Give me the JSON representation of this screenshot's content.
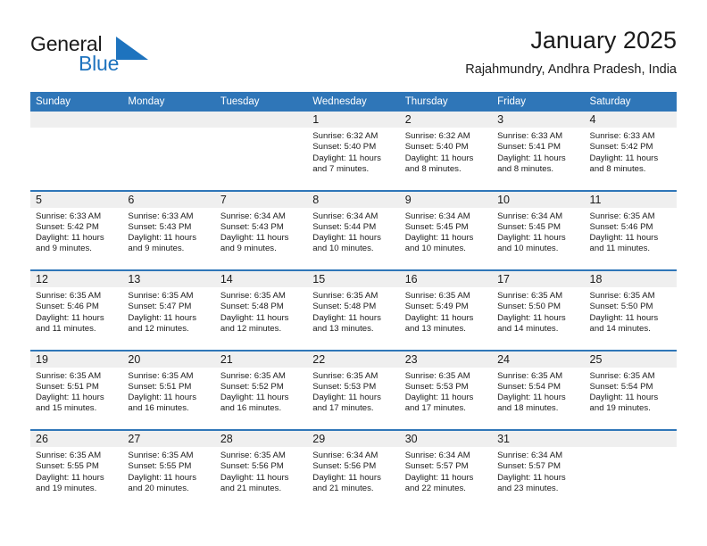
{
  "brand": {
    "name_dark": "General",
    "name_blue": "Blue",
    "triangle_color": "#1e73be"
  },
  "header": {
    "title": "January 2025",
    "subtitle": "Rajahmundry, Andhra Pradesh, India"
  },
  "theme": {
    "header_blue": "#2f76b8",
    "row_divider_blue": "#2f76b8",
    "day_band_gray": "#efefef",
    "text_color": "#1b1b1b",
    "brand_blue": "#1e73be"
  },
  "weekdays": [
    "Sunday",
    "Monday",
    "Tuesday",
    "Wednesday",
    "Thursday",
    "Friday",
    "Saturday"
  ],
  "weeks": [
    [
      {
        "day": "",
        "sunrise": "",
        "sunset": "",
        "daylight_line1": "",
        "daylight_line2": "",
        "empty": true
      },
      {
        "day": "",
        "sunrise": "",
        "sunset": "",
        "daylight_line1": "",
        "daylight_line2": "",
        "empty": true
      },
      {
        "day": "",
        "sunrise": "",
        "sunset": "",
        "daylight_line1": "",
        "daylight_line2": "",
        "empty": true
      },
      {
        "day": "1",
        "sunrise": "Sunrise: 6:32 AM",
        "sunset": "Sunset: 5:40 PM",
        "daylight_line1": "Daylight: 11 hours",
        "daylight_line2": "and 7 minutes.",
        "empty": false
      },
      {
        "day": "2",
        "sunrise": "Sunrise: 6:32 AM",
        "sunset": "Sunset: 5:40 PM",
        "daylight_line1": "Daylight: 11 hours",
        "daylight_line2": "and 8 minutes.",
        "empty": false
      },
      {
        "day": "3",
        "sunrise": "Sunrise: 6:33 AM",
        "sunset": "Sunset: 5:41 PM",
        "daylight_line1": "Daylight: 11 hours",
        "daylight_line2": "and 8 minutes.",
        "empty": false
      },
      {
        "day": "4",
        "sunrise": "Sunrise: 6:33 AM",
        "sunset": "Sunset: 5:42 PM",
        "daylight_line1": "Daylight: 11 hours",
        "daylight_line2": "and 8 minutes.",
        "empty": false
      }
    ],
    [
      {
        "day": "5",
        "sunrise": "Sunrise: 6:33 AM",
        "sunset": "Sunset: 5:42 PM",
        "daylight_line1": "Daylight: 11 hours",
        "daylight_line2": "and 9 minutes.",
        "empty": false
      },
      {
        "day": "6",
        "sunrise": "Sunrise: 6:33 AM",
        "sunset": "Sunset: 5:43 PM",
        "daylight_line1": "Daylight: 11 hours",
        "daylight_line2": "and 9 minutes.",
        "empty": false
      },
      {
        "day": "7",
        "sunrise": "Sunrise: 6:34 AM",
        "sunset": "Sunset: 5:43 PM",
        "daylight_line1": "Daylight: 11 hours",
        "daylight_line2": "and 9 minutes.",
        "empty": false
      },
      {
        "day": "8",
        "sunrise": "Sunrise: 6:34 AM",
        "sunset": "Sunset: 5:44 PM",
        "daylight_line1": "Daylight: 11 hours",
        "daylight_line2": "and 10 minutes.",
        "empty": false
      },
      {
        "day": "9",
        "sunrise": "Sunrise: 6:34 AM",
        "sunset": "Sunset: 5:45 PM",
        "daylight_line1": "Daylight: 11 hours",
        "daylight_line2": "and 10 minutes.",
        "empty": false
      },
      {
        "day": "10",
        "sunrise": "Sunrise: 6:34 AM",
        "sunset": "Sunset: 5:45 PM",
        "daylight_line1": "Daylight: 11 hours",
        "daylight_line2": "and 10 minutes.",
        "empty": false
      },
      {
        "day": "11",
        "sunrise": "Sunrise: 6:35 AM",
        "sunset": "Sunset: 5:46 PM",
        "daylight_line1": "Daylight: 11 hours",
        "daylight_line2": "and 11 minutes.",
        "empty": false
      }
    ],
    [
      {
        "day": "12",
        "sunrise": "Sunrise: 6:35 AM",
        "sunset": "Sunset: 5:46 PM",
        "daylight_line1": "Daylight: 11 hours",
        "daylight_line2": "and 11 minutes.",
        "empty": false
      },
      {
        "day": "13",
        "sunrise": "Sunrise: 6:35 AM",
        "sunset": "Sunset: 5:47 PM",
        "daylight_line1": "Daylight: 11 hours",
        "daylight_line2": "and 12 minutes.",
        "empty": false
      },
      {
        "day": "14",
        "sunrise": "Sunrise: 6:35 AM",
        "sunset": "Sunset: 5:48 PM",
        "daylight_line1": "Daylight: 11 hours",
        "daylight_line2": "and 12 minutes.",
        "empty": false
      },
      {
        "day": "15",
        "sunrise": "Sunrise: 6:35 AM",
        "sunset": "Sunset: 5:48 PM",
        "daylight_line1": "Daylight: 11 hours",
        "daylight_line2": "and 13 minutes.",
        "empty": false
      },
      {
        "day": "16",
        "sunrise": "Sunrise: 6:35 AM",
        "sunset": "Sunset: 5:49 PM",
        "daylight_line1": "Daylight: 11 hours",
        "daylight_line2": "and 13 minutes.",
        "empty": false
      },
      {
        "day": "17",
        "sunrise": "Sunrise: 6:35 AM",
        "sunset": "Sunset: 5:50 PM",
        "daylight_line1": "Daylight: 11 hours",
        "daylight_line2": "and 14 minutes.",
        "empty": false
      },
      {
        "day": "18",
        "sunrise": "Sunrise: 6:35 AM",
        "sunset": "Sunset: 5:50 PM",
        "daylight_line1": "Daylight: 11 hours",
        "daylight_line2": "and 14 minutes.",
        "empty": false
      }
    ],
    [
      {
        "day": "19",
        "sunrise": "Sunrise: 6:35 AM",
        "sunset": "Sunset: 5:51 PM",
        "daylight_line1": "Daylight: 11 hours",
        "daylight_line2": "and 15 minutes.",
        "empty": false
      },
      {
        "day": "20",
        "sunrise": "Sunrise: 6:35 AM",
        "sunset": "Sunset: 5:51 PM",
        "daylight_line1": "Daylight: 11 hours",
        "daylight_line2": "and 16 minutes.",
        "empty": false
      },
      {
        "day": "21",
        "sunrise": "Sunrise: 6:35 AM",
        "sunset": "Sunset: 5:52 PM",
        "daylight_line1": "Daylight: 11 hours",
        "daylight_line2": "and 16 minutes.",
        "empty": false
      },
      {
        "day": "22",
        "sunrise": "Sunrise: 6:35 AM",
        "sunset": "Sunset: 5:53 PM",
        "daylight_line1": "Daylight: 11 hours",
        "daylight_line2": "and 17 minutes.",
        "empty": false
      },
      {
        "day": "23",
        "sunrise": "Sunrise: 6:35 AM",
        "sunset": "Sunset: 5:53 PM",
        "daylight_line1": "Daylight: 11 hours",
        "daylight_line2": "and 17 minutes.",
        "empty": false
      },
      {
        "day": "24",
        "sunrise": "Sunrise: 6:35 AM",
        "sunset": "Sunset: 5:54 PM",
        "daylight_line1": "Daylight: 11 hours",
        "daylight_line2": "and 18 minutes.",
        "empty": false
      },
      {
        "day": "25",
        "sunrise": "Sunrise: 6:35 AM",
        "sunset": "Sunset: 5:54 PM",
        "daylight_line1": "Daylight: 11 hours",
        "daylight_line2": "and 19 minutes.",
        "empty": false
      }
    ],
    [
      {
        "day": "26",
        "sunrise": "Sunrise: 6:35 AM",
        "sunset": "Sunset: 5:55 PM",
        "daylight_line1": "Daylight: 11 hours",
        "daylight_line2": "and 19 minutes.",
        "empty": false
      },
      {
        "day": "27",
        "sunrise": "Sunrise: 6:35 AM",
        "sunset": "Sunset: 5:55 PM",
        "daylight_line1": "Daylight: 11 hours",
        "daylight_line2": "and 20 minutes.",
        "empty": false
      },
      {
        "day": "28",
        "sunrise": "Sunrise: 6:35 AM",
        "sunset": "Sunset: 5:56 PM",
        "daylight_line1": "Daylight: 11 hours",
        "daylight_line2": "and 21 minutes.",
        "empty": false
      },
      {
        "day": "29",
        "sunrise": "Sunrise: 6:34 AM",
        "sunset": "Sunset: 5:56 PM",
        "daylight_line1": "Daylight: 11 hours",
        "daylight_line2": "and 21 minutes.",
        "empty": false
      },
      {
        "day": "30",
        "sunrise": "Sunrise: 6:34 AM",
        "sunset": "Sunset: 5:57 PM",
        "daylight_line1": "Daylight: 11 hours",
        "daylight_line2": "and 22 minutes.",
        "empty": false
      },
      {
        "day": "31",
        "sunrise": "Sunrise: 6:34 AM",
        "sunset": "Sunset: 5:57 PM",
        "daylight_line1": "Daylight: 11 hours",
        "daylight_line2": "and 23 minutes.",
        "empty": false
      },
      {
        "day": "",
        "sunrise": "",
        "sunset": "",
        "daylight_line1": "",
        "daylight_line2": "",
        "empty": true
      }
    ]
  ]
}
